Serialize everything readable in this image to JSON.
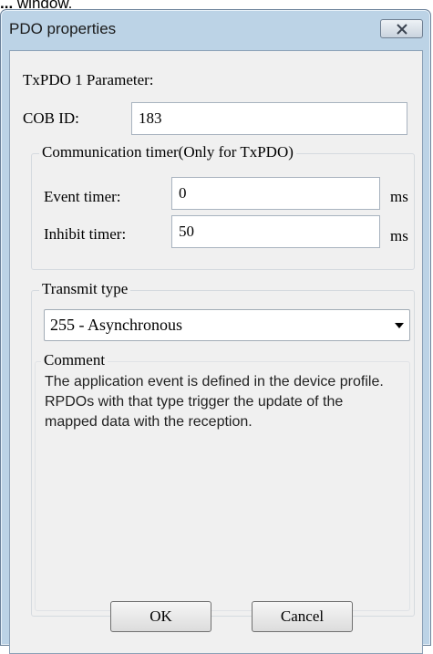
{
  "caption": {
    "fragment_bold": "...",
    "fragment_tail": " window."
  },
  "window": {
    "title": "PDO properties",
    "close_icon": "close-icon"
  },
  "pdo": {
    "heading": "TxPDO 1 Parameter:",
    "cob_id_label": "COB ID:",
    "cob_id_value": "183"
  },
  "communication_timer": {
    "group_title": "Communication timer(Only for TxPDO)",
    "event_timer_label": "Event timer:",
    "event_timer_value": "0",
    "event_timer_unit": "ms",
    "inhibit_timer_label": "Inhibit timer:",
    "inhibit_timer_value": "50",
    "inhibit_timer_unit": "ms"
  },
  "transmit": {
    "group_title": "Transmit type",
    "selected": "255 - Asynchronous",
    "comment_title": "Comment",
    "comment_text": "The application event is defined in the device profile. RPDOs with that type trigger the update of the mapped data with the reception."
  },
  "buttons": {
    "ok": "OK",
    "cancel": "Cancel"
  }
}
